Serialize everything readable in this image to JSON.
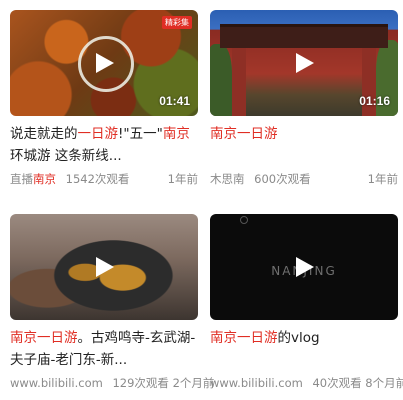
{
  "videos": [
    {
      "title_parts": [
        "说走就走的",
        "一日游",
        "!\"五一\"",
        "南京",
        "环城游 这条新线..."
      ],
      "duration": "01:41",
      "badge": "精彩集",
      "author_parts": [
        "直播",
        "南京"
      ],
      "views": "1542次观看",
      "time": "1年前"
    },
    {
      "title_parts": [
        "南京一日游"
      ],
      "duration": "01:16",
      "author": "木思南",
      "views": "600次观看",
      "time": "1年前"
    },
    {
      "title_parts": [
        "南京一日游",
        "。古鸡鸣寺-玄武湖-夫子庙-老门东-新..."
      ],
      "author": "www.bilibili.com",
      "views": "129次观看",
      "time": "2个月前"
    },
    {
      "title_parts": [
        "南京一日游",
        "的vlog"
      ],
      "overlay_text": "NANJING",
      "author": "www.bilibili.com",
      "views": "40次观看",
      "time": "8个月前"
    }
  ],
  "colors": {
    "highlight": "#e02e24",
    "meta": "#8a8a8a"
  },
  "icons": {
    "play": "play-icon"
  }
}
